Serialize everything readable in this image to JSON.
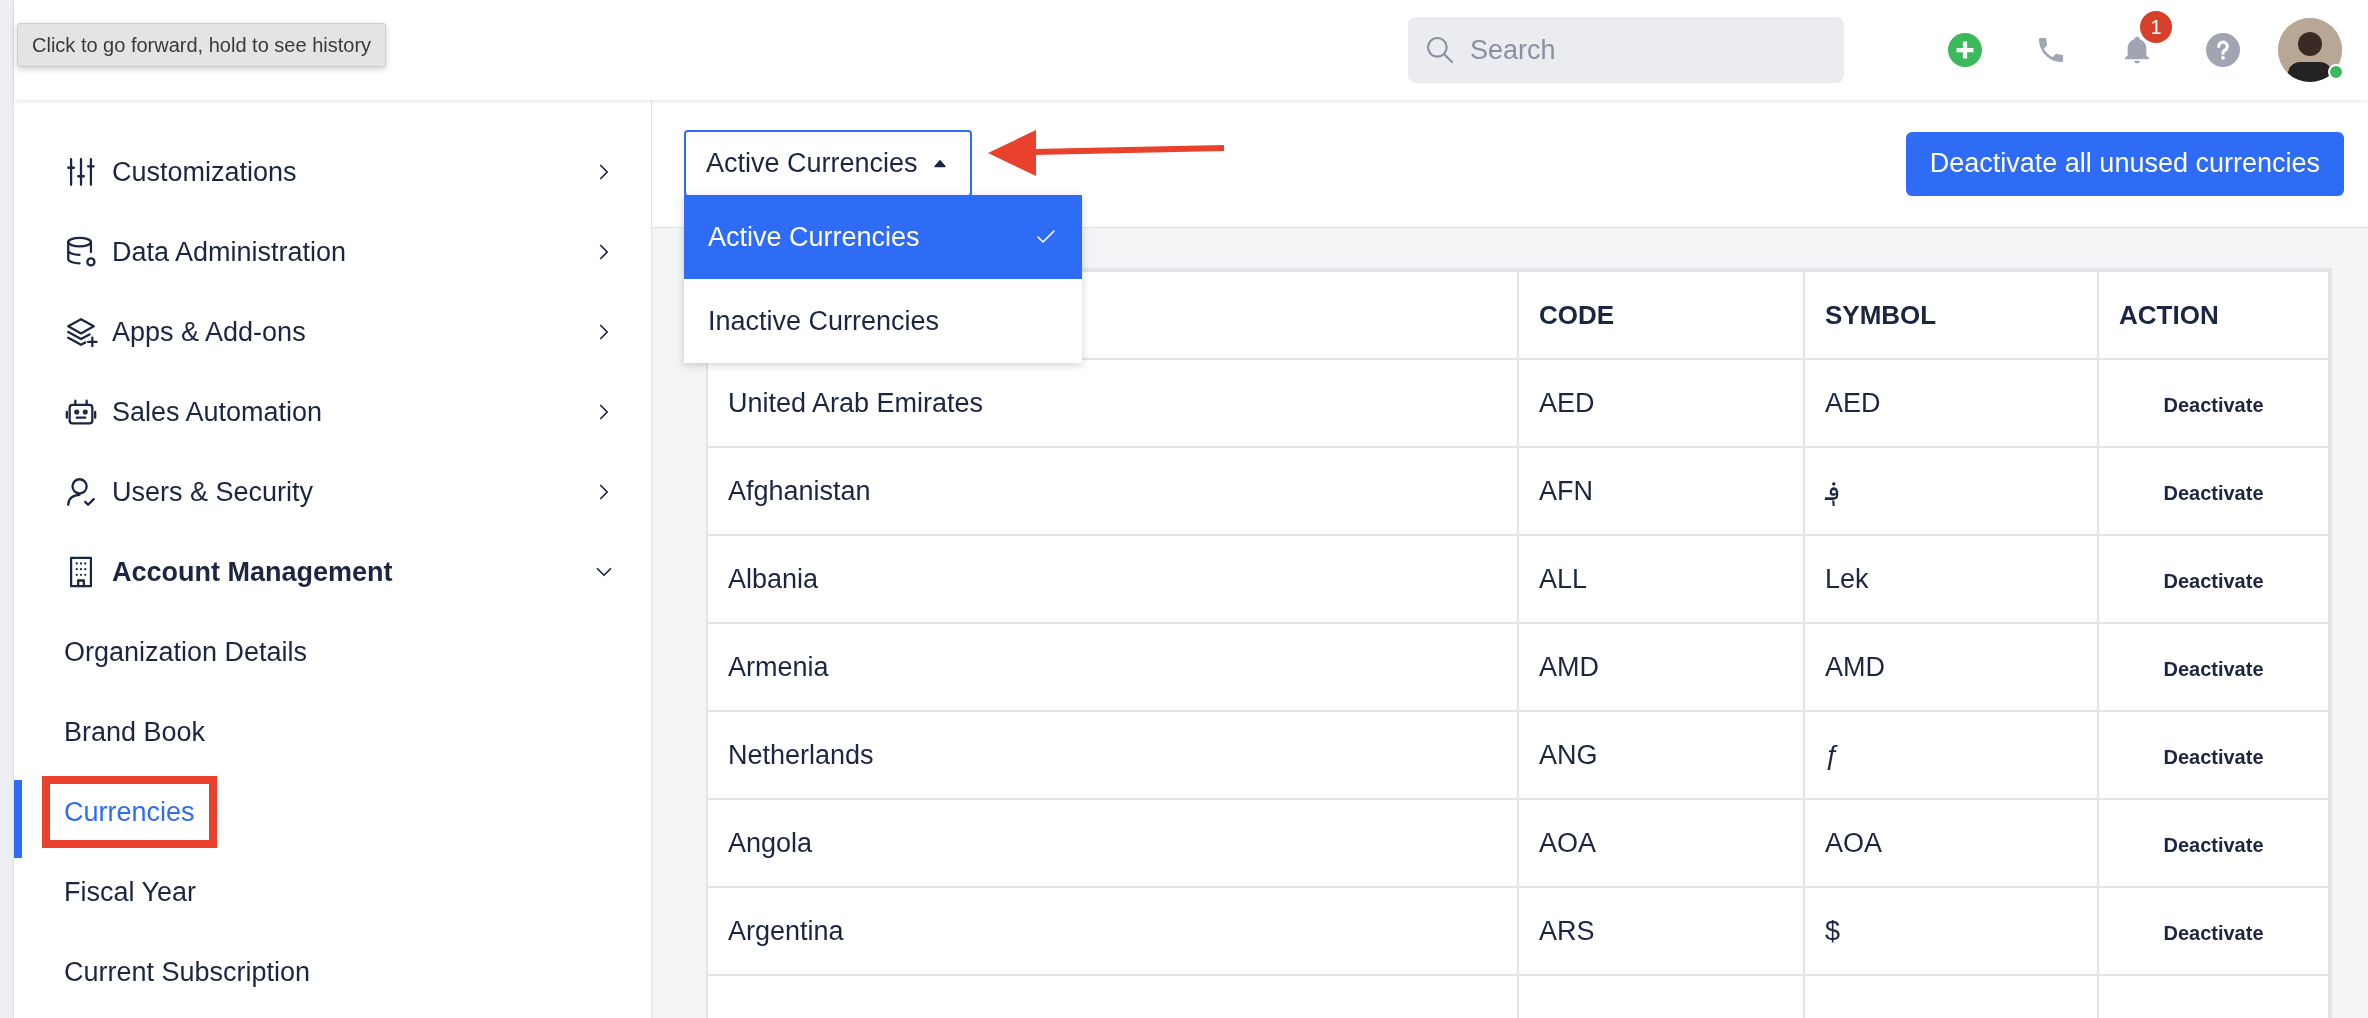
{
  "tooltip": "Click to go forward, hold to see history",
  "header": {
    "search": {
      "placeholder": "Search"
    },
    "notification_count": "1",
    "user_online": true
  },
  "sidebar": {
    "items": [
      {
        "label": "Customizations",
        "expanded": false
      },
      {
        "label": "Data Administration",
        "expanded": false
      },
      {
        "label": "Apps & Add-ons",
        "expanded": false
      },
      {
        "label": "Sales Automation",
        "expanded": false
      },
      {
        "label": "Users & Security",
        "expanded": false
      },
      {
        "label": "Account Management",
        "expanded": true,
        "children": [
          {
            "label": "Organization Details",
            "selected": false,
            "callout": false
          },
          {
            "label": "Brand Book",
            "selected": false,
            "callout": false
          },
          {
            "label": "Currencies",
            "selected": true,
            "callout": true
          },
          {
            "label": "Fiscal Year",
            "selected": false,
            "callout": false
          },
          {
            "label": "Current Subscription",
            "selected": false,
            "callout": false
          }
        ]
      }
    ]
  },
  "filter": {
    "label": "Active Currencies",
    "expanded": true,
    "callout_arrow": true,
    "options": [
      {
        "label": "Active Currencies",
        "selected": true
      },
      {
        "label": "Inactive Currencies",
        "selected": false
      }
    ]
  },
  "deactivate_all_button": "Deactivate all unused currencies",
  "table": {
    "columns": [
      "CODE",
      "SYMBOL",
      "ACTION"
    ],
    "rows": [
      {
        "country": "United Arab Emirates",
        "code": "AED",
        "symbol": "AED",
        "action": "Deactivate"
      },
      {
        "country": "Afghanistan",
        "code": "AFN",
        "symbol": "؋",
        "action": "Deactivate"
      },
      {
        "country": "Albania",
        "code": "ALL",
        "symbol": "Lek",
        "action": "Deactivate"
      },
      {
        "country": "Armenia",
        "code": "AMD",
        "symbol": "AMD",
        "action": "Deactivate"
      },
      {
        "country": "Netherlands",
        "code": "ANG",
        "symbol": "ƒ",
        "action": "Deactivate"
      },
      {
        "country": "Angola",
        "code": "AOA",
        "symbol": "AOA",
        "action": "Deactivate"
      },
      {
        "country": "Argentina",
        "code": "ARS",
        "symbol": "$",
        "action": "Deactivate"
      }
    ]
  }
}
